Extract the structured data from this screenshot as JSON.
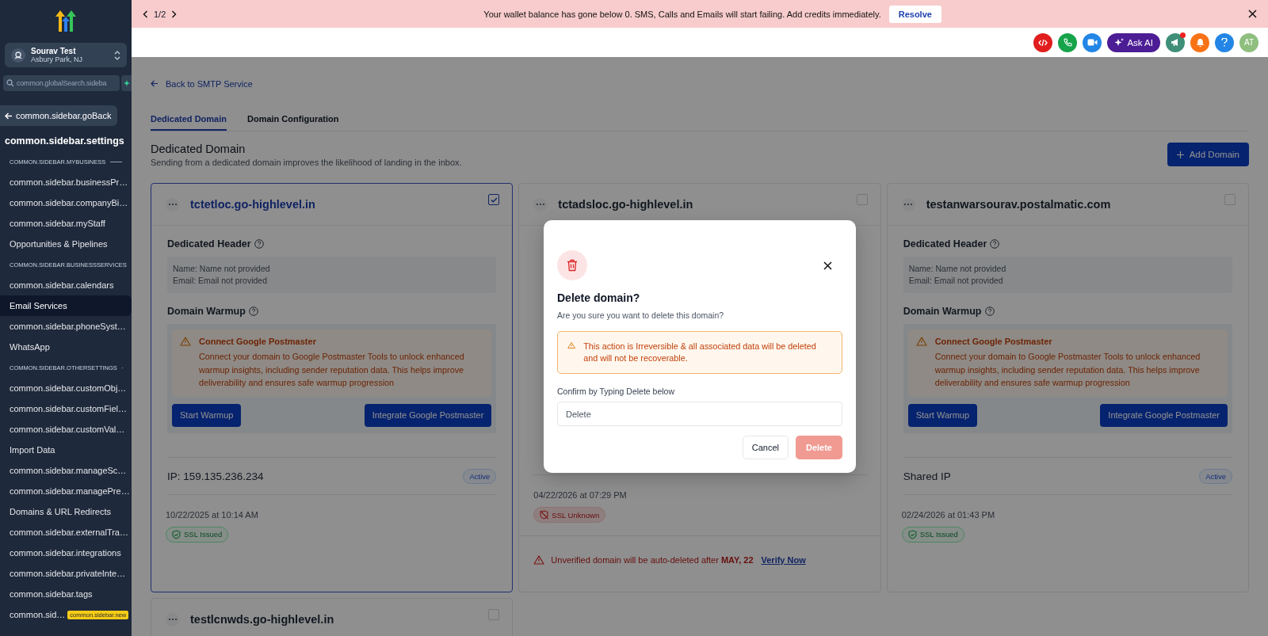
{
  "banner": {
    "pager": "1/2",
    "message": "Your wallet balance has gone below 0. SMS, Calls and Emails will start failing. Add credits immediately.",
    "action": "Resolve"
  },
  "header": {
    "ask_ai": "Ask AI",
    "avatar": "AT",
    "notification_dot": true
  },
  "sidebar": {
    "account": {
      "name": "Sourav Test",
      "location": "Asbury Park, NJ"
    },
    "search": {
      "placeholder": "common.globalSearch.sideba"
    },
    "back": "common.sidebar.goBack",
    "title": "common.sidebar.settings",
    "items": [
      {
        "kind": "section",
        "label": "COMMON.SIDEBAR.MYBUSINESS"
      },
      {
        "kind": "item",
        "label": "common.sidebar.businessPr…",
        "selected": false
      },
      {
        "kind": "item",
        "label": "common.sidebar.companyBi…",
        "selected": false
      },
      {
        "kind": "item",
        "label": "common.sidebar.myStaff",
        "selected": false
      },
      {
        "kind": "item",
        "label": "Opportunities & Pipelines",
        "selected": false
      },
      {
        "kind": "section",
        "label": "COMMON.SIDEBAR.BUSINESSSERVICES"
      },
      {
        "kind": "item",
        "label": "common.sidebar.calendars",
        "selected": false
      },
      {
        "kind": "item",
        "label": "Email Services",
        "selected": true
      },
      {
        "kind": "item",
        "label": "common.sidebar.phoneSyst…",
        "selected": false
      },
      {
        "kind": "item",
        "label": "WhatsApp",
        "selected": false
      },
      {
        "kind": "section",
        "label": "COMMON.SIDEBAR.OTHERSETTINGS"
      },
      {
        "kind": "item",
        "label": "common.sidebar.customObj…",
        "selected": false
      },
      {
        "kind": "item",
        "label": "common.sidebar.customFiel…",
        "selected": false
      },
      {
        "kind": "item",
        "label": "common.sidebar.customVal…",
        "selected": false
      },
      {
        "kind": "item",
        "label": "Import Data",
        "selected": false
      },
      {
        "kind": "item",
        "label": "common.sidebar.manageSc…",
        "selected": false
      },
      {
        "kind": "item",
        "label": "common.sidebar.managePre…",
        "selected": false
      },
      {
        "kind": "item",
        "label": "Domains & URL Redirects",
        "selected": false
      },
      {
        "kind": "item",
        "label": "common.sidebar.externalTra…",
        "selected": false
      },
      {
        "kind": "item",
        "label": "common.sidebar.integrations",
        "selected": false
      },
      {
        "kind": "item",
        "label": "common.sidebar.privateInte…",
        "selected": false
      },
      {
        "kind": "item",
        "label": "common.sidebar.tags",
        "selected": false
      },
      {
        "kind": "item",
        "label": "common.sid…",
        "badge": "common.sidebar.new",
        "selected": false
      }
    ]
  },
  "main": {
    "back_link": "Back to SMTP Service",
    "tabs": [
      {
        "label": "Dedicated Domain",
        "selected": true
      },
      {
        "label": "Domain Configuration",
        "selected": false
      }
    ],
    "title": "Dedicated Domain",
    "subtitle": "Sending from a dedicated domain improves the likelihood of landing in the inbox.",
    "add_button": "Add Domain"
  },
  "cards": [
    {
      "domain": "tctetloc.go-highlevel.in",
      "selected": true,
      "header_label": "Dedicated Header",
      "name_line": "Name: Name not provided",
      "email_line": "Email: Email not provided",
      "warmup_label": "Domain Warmup",
      "alert_title": "Connect Google Postmaster",
      "alert_text": "Connect your domain to Google Postmaster Tools to unlock enhanced warmup insights, including sender reputation data. This helps improve deliverability and ensures safe warmup progression",
      "start_button": "Start Warmup",
      "integrate_button": "Integrate Google Postmaster",
      "ip": "IP: 159.135.236.234",
      "status": "Active",
      "date": "10/22/2025 at 10:14 AM",
      "ssl": {
        "kind": "issued",
        "label": "SSL Issued"
      }
    },
    {
      "domain": "tctadsloc.go-highlevel.in",
      "selected": false,
      "date": "04/22/2026 at 07:29 PM",
      "ssl": {
        "kind": "unknown",
        "label": "SSL Unknown"
      },
      "warning": "Unverified domain will be auto-deleted after **MAY, 22**",
      "warning_link": "Verify Now"
    },
    {
      "domain": "testanwarsourav.postalmatic.com",
      "selected": false,
      "header_label": "Dedicated Header",
      "name_line": "Name: Name not provided",
      "email_line": "Email: Email not provided",
      "warmup_label": "Domain Warmup",
      "alert_title": "Connect Google Postmaster",
      "alert_text": "Connect your domain to Google Postmaster Tools to unlock enhanced warmup insights, including sender reputation data. This helps improve deliverability and ensures safe warmup progression",
      "start_button": "Start Warmup",
      "integrate_button": "Integrate Google Postmaster",
      "ip": "Shared IP",
      "status": "Active",
      "date": "02/24/2026 at 01:43 PM",
      "ssl": {
        "kind": "issued",
        "label": "SSL Issued"
      }
    },
    {
      "domain": "testlcnwds.go-highlevel.in",
      "selected": false
    }
  ],
  "modal": {
    "title": "Delete domain?",
    "message": "Are you sure you want to delete this domain?",
    "warning": "This action is Irreversible & all associated data will be deleted and will not be recoverable.",
    "confirm_label": "Confirm by Typing Delete below",
    "input_placeholder": "Delete",
    "cancel": "Cancel",
    "delete": {
      "label": "Delete",
      "disabled": true
    }
  }
}
